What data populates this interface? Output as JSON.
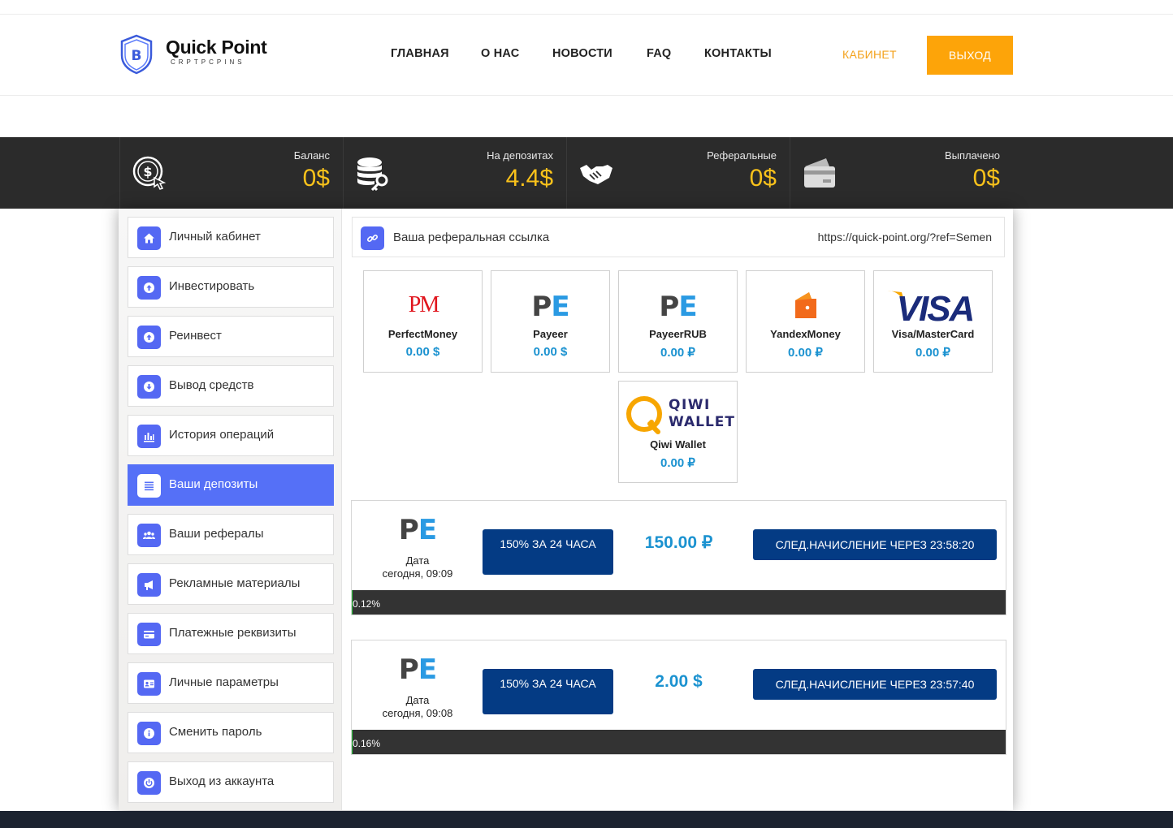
{
  "brand": {
    "name": "Quick Point",
    "tagline": "CRPTPCPINS"
  },
  "nav": {
    "items": [
      "ГЛАВНАЯ",
      "О НАС",
      "НОВОСТИ",
      "FAQ",
      "КОНТАКТЫ"
    ],
    "cabinet": "КАБИНЕТ",
    "logout": "ВЫХОД"
  },
  "stats": [
    {
      "label": "Баланс",
      "value": "0$",
      "icon": "dollar-coin-cursor-icon"
    },
    {
      "label": "На депозитах",
      "value": "4.4$",
      "icon": "database-key-icon"
    },
    {
      "label": "Реферальные",
      "value": "0$",
      "icon": "handshake-icon"
    },
    {
      "label": "Выплачено",
      "value": "0$",
      "icon": "wallet-card-icon"
    }
  ],
  "sidebar": {
    "items": [
      {
        "label": "Личный кабинет",
        "icon": "home-icon"
      },
      {
        "label": "Инвестировать",
        "icon": "arrow-up-circle-icon"
      },
      {
        "label": "Реинвест",
        "icon": "arrow-up-circle-icon"
      },
      {
        "label": "Вывод средств",
        "icon": "arrow-down-circle-icon"
      },
      {
        "label": "История операций",
        "icon": "bar-chart-icon"
      },
      {
        "label": "Ваши депозиты",
        "icon": "list-icon",
        "active": true
      },
      {
        "label": "Ваши рефералы",
        "icon": "users-icon"
      },
      {
        "label": "Рекламные материалы",
        "icon": "megaphone-icon"
      },
      {
        "label": "Платежные реквизиты",
        "icon": "credit-card-icon"
      },
      {
        "label": "Личные параметры",
        "icon": "id-card-icon"
      },
      {
        "label": "Сменить пароль",
        "icon": "info-icon"
      },
      {
        "label": "Выход из аккаунта",
        "icon": "power-icon"
      }
    ]
  },
  "referral": {
    "label": "Ваша реферальная ссылка",
    "url": "https://quick-point.org/?ref=Semen"
  },
  "payment_systems": [
    {
      "name": "PerfectMoney",
      "amount": "0.00 $",
      "logo_text": "PM"
    },
    {
      "name": "Payeer",
      "amount": "0.00 $",
      "logo_text": "PE"
    },
    {
      "name": "PayeerRUB",
      "amount": "0.00 ₽",
      "logo_text": "PE"
    },
    {
      "name": "YandexMoney",
      "amount": "0.00 ₽",
      "logo_text": ""
    },
    {
      "name": "Visa/MasterCard",
      "amount": "0.00 ₽",
      "logo_text": "VISA"
    },
    {
      "name": "Qiwi Wallet",
      "amount": "0.00 ₽",
      "logo_text": "QIWI WALLET"
    }
  ],
  "deposits": [
    {
      "date_label": "Дата",
      "date": "сегодня, 09:09",
      "plan": "150% ЗА 24 ЧАСА",
      "amount": "150.00 ₽",
      "next": "СЛЕД.НАЧИСЛЕНИЕ ЧЕРЕЗ 23:58:20",
      "progress": "0.12%",
      "progress_fraction": 0.0012
    },
    {
      "date_label": "Дата",
      "date": "сегодня, 09:08",
      "plan": "150% ЗА 24 ЧАСА",
      "amount": "2.00 $",
      "next": "СЛЕД.НАЧИСЛЕНИЕ ЧЕРЕЗ 23:57:40",
      "progress": "0.16%",
      "progress_fraction": 0.0016
    }
  ],
  "colors": {
    "accent": "#fda409",
    "stat_value": "#f9c21b",
    "active_menu": "#5570f7",
    "icon_bg": "#5468f3",
    "amount": "#1b92d0",
    "dark_button": "#043b84",
    "statsbar": "#2b2b2b"
  }
}
